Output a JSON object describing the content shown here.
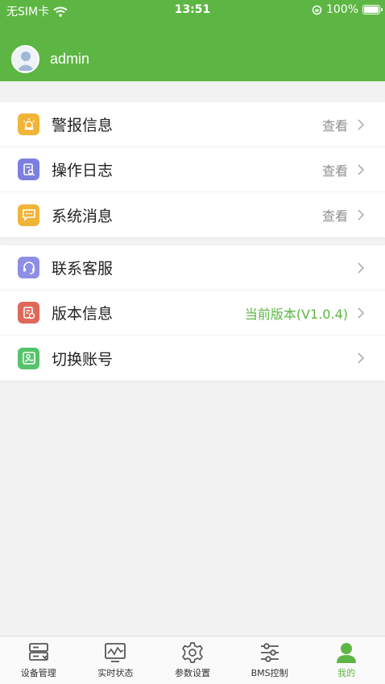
{
  "status_bar": {
    "carrier": "无SIM卡",
    "time": "13:51",
    "battery": "100%"
  },
  "user": {
    "name": "admin"
  },
  "menu_group_1": [
    {
      "label": "警报信息",
      "value": "查看",
      "icon": "alarm-light-icon",
      "color": "#f0b437"
    },
    {
      "label": "操作日志",
      "value": "查看",
      "icon": "log-search-icon",
      "color": "#7b7fe0"
    },
    {
      "label": "系统消息",
      "value": "查看",
      "icon": "message-icon",
      "color": "#f0b437"
    }
  ],
  "menu_group_2": [
    {
      "label": "联系客服",
      "value": "",
      "icon": "headset-icon",
      "color": "#8f8ee6"
    },
    {
      "label": "版本信息",
      "value": "当前版本(V1.0.4)",
      "icon": "version-icon",
      "color": "#e0685a"
    },
    {
      "label": "切换账号",
      "value": "",
      "icon": "switch-user-icon",
      "color": "#55c46b"
    }
  ],
  "tabbar": {
    "tabs": [
      {
        "label": "设备管理",
        "icon": "device-icon",
        "active": false
      },
      {
        "label": "实时状态",
        "icon": "realtime-chart-icon",
        "active": false
      },
      {
        "label": "参数设置",
        "icon": "gear-icon",
        "active": false
      },
      {
        "label": "BMS控制",
        "icon": "sliders-icon",
        "active": false
      },
      {
        "label": "我的",
        "icon": "user-icon",
        "active": true
      }
    ]
  },
  "colors": {
    "accent": "#5db643",
    "background": "#f2f2f2"
  }
}
